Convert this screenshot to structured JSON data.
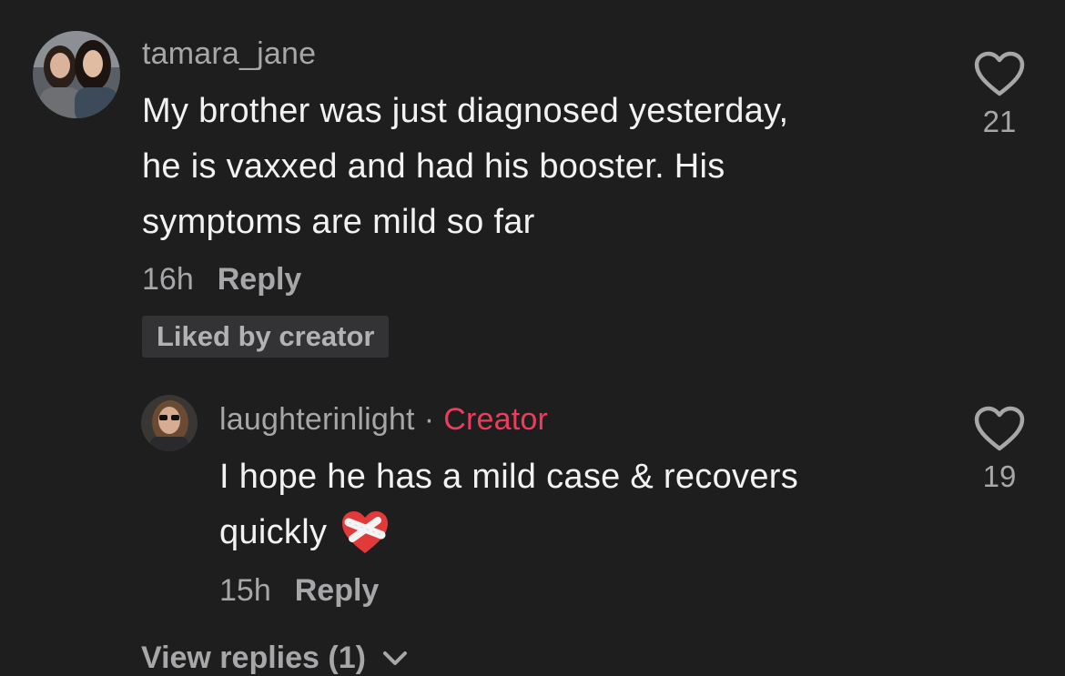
{
  "comments": [
    {
      "username": "tamara_jane",
      "text_lines": [
        "My brother was just diagnosed yesterday,",
        "he is vaxxed and had his booster. His",
        "symptoms are mild so far"
      ],
      "time": "16h",
      "reply_label": "Reply",
      "liked_badge": "Liked by creator",
      "like_count": "21",
      "like_icon": "heart-outline-icon"
    }
  ],
  "reply": {
    "username": "laughterinlight",
    "separator": "·",
    "creator_label": "Creator",
    "text_line_1": "I hope he has a mild case & recovers",
    "text_line_2": "quickly",
    "emoji_icon": "mending-heart-icon",
    "time": "15h",
    "reply_label": "Reply",
    "like_count": "19",
    "like_icon": "heart-outline-icon"
  },
  "view_replies_label": "View replies (1)",
  "colors": {
    "background": "#1e1e1f",
    "secondary_text": "#a7a7a9",
    "creator_accent": "#ea3e5c",
    "badge_bg": "#333335"
  }
}
